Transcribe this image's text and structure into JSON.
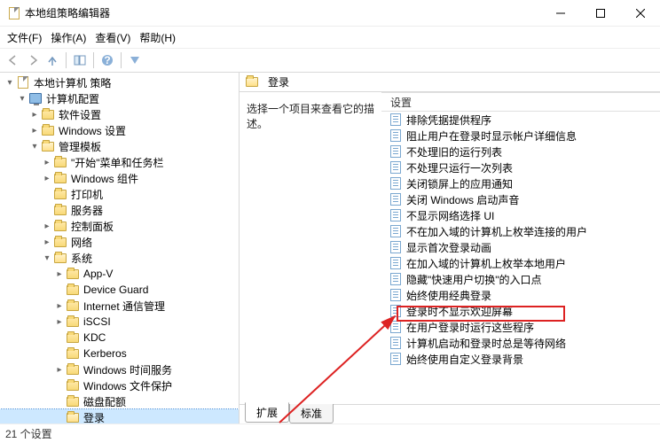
{
  "window": {
    "title": "本地组策略编辑器"
  },
  "menu": {
    "file": "文件(F)",
    "action": "操作(A)",
    "view": "查看(V)",
    "help": "帮助(H)"
  },
  "tree": {
    "root": "本地计算机 策略",
    "computer_config": "计算机配置",
    "software_settings": "软件设置",
    "windows_settings": "Windows 设置",
    "admin_templates": "管理模板",
    "start_taskbar": "\"开始\"菜单和任务栏",
    "windows_components": "Windows 组件",
    "printers": "打印机",
    "server": "服务器",
    "control_panel": "控制面板",
    "network": "网络",
    "system": "系统",
    "appv": "App-V",
    "device_guard": "Device Guard",
    "internet_comm": "Internet 通信管理",
    "iscsi": "iSCSI",
    "kdc": "KDC",
    "kerberos": "Kerberos",
    "win_time": "Windows 时间服务",
    "win_file_protect": "Windows 文件保护",
    "disk_quota": "磁盘配额",
    "logon": "登录"
  },
  "panel": {
    "header": "登录",
    "description": "选择一个项目来查看它的描述。",
    "column": "设置"
  },
  "policies": [
    "排除凭据提供程序",
    "阻止用户在登录时显示帐户详细信息",
    "不处理旧的运行列表",
    "不处理只运行一次列表",
    "关闭锁屏上的应用通知",
    "关闭 Windows 启动声音",
    "不显示网络选择 UI",
    "不在加入域的计算机上枚举连接的用户",
    "显示首次登录动画",
    "在加入域的计算机上枚举本地用户",
    "隐藏\"快速用户切换\"的入口点",
    "始终使用经典登录",
    "登录时不显示欢迎屏幕",
    "在用户登录时运行这些程序",
    "计算机启动和登录时总是等待网络",
    "始终使用自定义登录背景"
  ],
  "highlight_index": 12,
  "tabs": {
    "extended": "扩展",
    "standard": "标准"
  },
  "status": "21 个设置"
}
